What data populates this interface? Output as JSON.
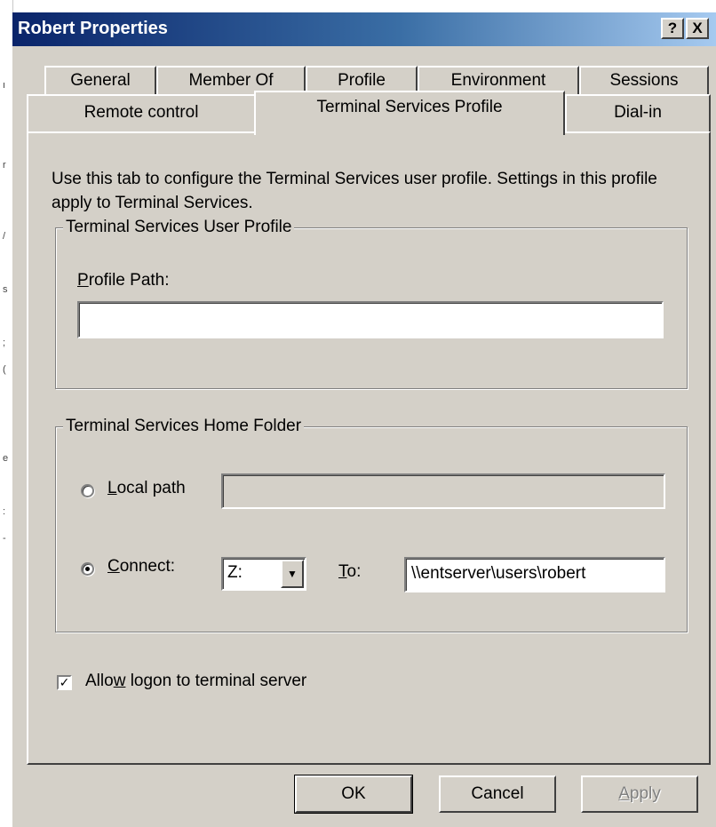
{
  "window": {
    "title": "Robert Properties",
    "help_button": "?",
    "close_button": "X"
  },
  "tabs": {
    "row_back": [
      "General",
      "Member Of",
      "Profile",
      "Environment",
      "Sessions"
    ],
    "row_front": [
      "Remote control",
      "Terminal Services Profile",
      "Dial-in"
    ],
    "active": "Terminal Services Profile"
  },
  "panel": {
    "description": "Use this tab to configure the Terminal Services user profile. Settings in this profile apply to Terminal Services.",
    "profile_group": {
      "legend": "Terminal Services User Profile",
      "profile_path_label_mnemonic": "P",
      "profile_path_label_rest": "rofile Path:",
      "profile_path_value": ""
    },
    "home_group": {
      "legend": "Terminal Services Home Folder",
      "local_path_mnemonic": "L",
      "local_path_rest": "ocal path",
      "local_path_value": "",
      "connect_mnemonic": "C",
      "connect_rest": "onnect:",
      "drive_value": "Z:",
      "to_mnemonic": "T",
      "to_rest": "o:",
      "to_value": "\\\\entserver\\users\\robert",
      "selected": "connect"
    },
    "allow_logon": {
      "label_pre": "Allo",
      "label_mnemonic": "w",
      "label_post": " logon to terminal server",
      "checked": true
    }
  },
  "buttons": {
    "ok": "OK",
    "cancel": "Cancel",
    "apply_mnemonic": "A",
    "apply_rest": "pply"
  }
}
